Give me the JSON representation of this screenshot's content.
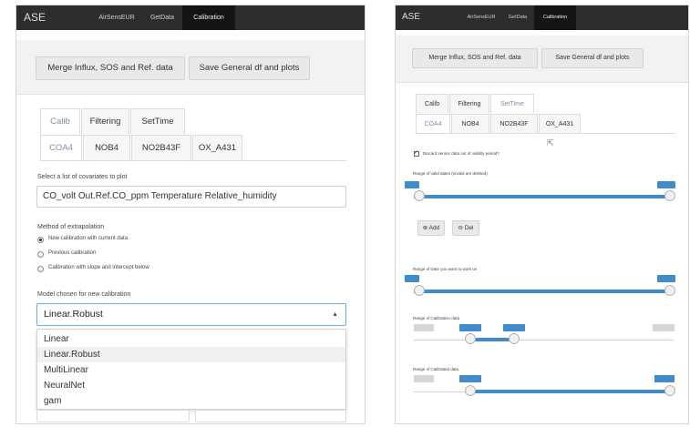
{
  "left": {
    "nav": {
      "brand": "ASE",
      "items": [
        "AirSensEUR",
        "GetData",
        "Calibration"
      ],
      "active": "Calibration"
    },
    "buttons": {
      "merge": "Merge Influx, SOS and Ref. data",
      "save": "Save General df and plots"
    },
    "tabs_row1": [
      "Calib",
      "Filtering",
      "SetTime"
    ],
    "tabs_row2": [
      "COA4",
      "NOB4",
      "NO2B43F",
      "OX_A431"
    ],
    "covariates": {
      "label": "Select a list of covariates to plot",
      "value": "CO_volt  Out.Ref.CO_ppm  Temperature  Relative_humidity"
    },
    "extrapolation": {
      "label": "Method of extrapolation",
      "options": [
        "New calibration with current data",
        "Previous calibration",
        "Calibration with slope and intercept below"
      ],
      "selected": 0
    },
    "model": {
      "label": "Model chosen for new calibration",
      "value": "Linear.Robust",
      "options": [
        "Linear",
        "Linear.Robust",
        "MultiLinear",
        "NeuralNet",
        "gam"
      ],
      "highlighted": 1
    }
  },
  "right": {
    "nav": {
      "brand": "ASE",
      "items": [
        "AirSensEUR",
        "GetData",
        "Calibration"
      ],
      "active": "Calibration"
    },
    "buttons": {
      "merge": "Merge Influx, SOS and Ref. data",
      "save": "Save General df and plots"
    },
    "tabs_row1": [
      "Calib",
      "Filtering",
      "SetTime"
    ],
    "tabs_row2": [
      "COA4",
      "NOB4",
      "NO2B43F",
      "OX_A431"
    ],
    "discard_label": "Discard sensor data out of validity period?",
    "sliders": [
      {
        "label": "Range of valid dates (invalid are deleted)"
      },
      {
        "label": "Range of Date you want to work on"
      },
      {
        "label": "Range of Calibration data"
      },
      {
        "label": "Range of Calibrated data"
      }
    ],
    "add_button": "Add",
    "del_button": "Del"
  }
}
